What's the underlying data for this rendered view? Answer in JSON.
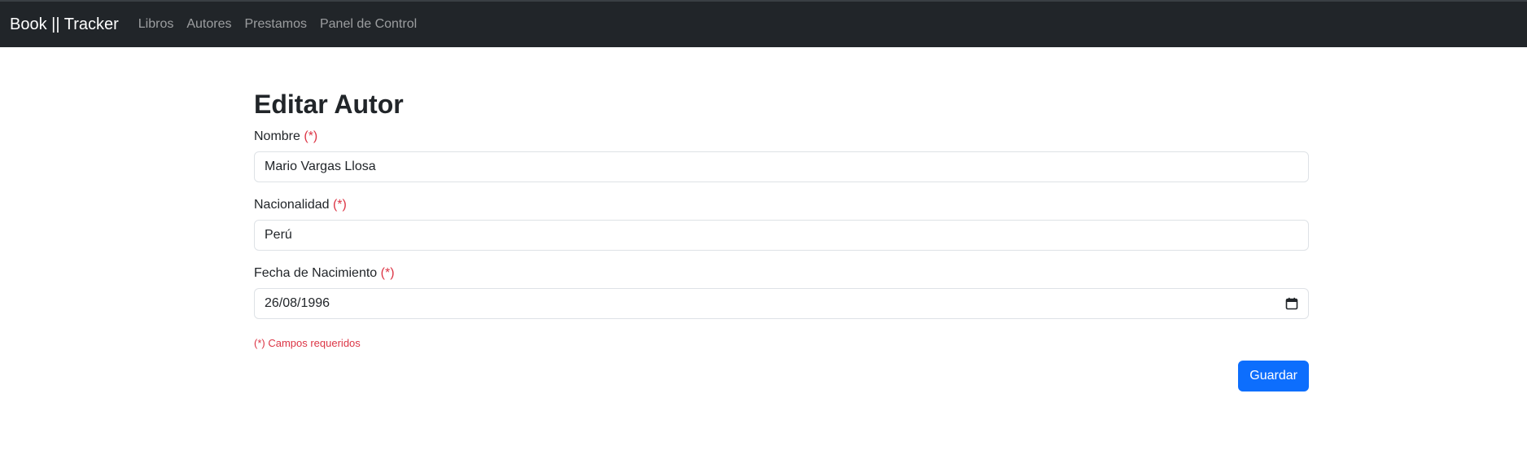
{
  "navbar": {
    "brand": "Book || Tracker",
    "links": [
      "Libros",
      "Autores",
      "Prestamos",
      "Panel de Control"
    ]
  },
  "form": {
    "title": "Editar Autor",
    "required_marker": "(*)",
    "fields": [
      {
        "label": "Nombre",
        "value": "Mario Vargas Llosa"
      },
      {
        "label": "Nacionalidad",
        "value": "Perú"
      },
      {
        "label": "Fecha de Nacimiento",
        "value": "26/08/1996",
        "icon": "calendar-icon"
      }
    ],
    "required_note": "(*) Campos requeridos",
    "submit_label": "Guardar"
  },
  "colors": {
    "navbar_bg": "#212529",
    "required": "#dc3545",
    "primary": "#0d6efd"
  }
}
